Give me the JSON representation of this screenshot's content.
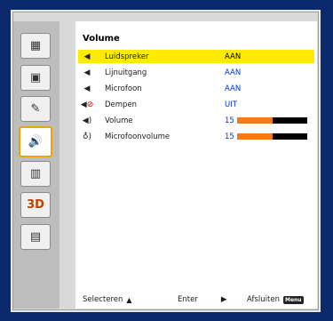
{
  "menu": {
    "title": "Volume",
    "items": [
      {
        "label": "Luidspreker",
        "value": "AAN",
        "icon": "speaker-icon",
        "selected": true
      },
      {
        "label": "Lijnuitgang",
        "value": "AAN",
        "icon": "speaker-icon",
        "selected": false
      },
      {
        "label": "Microfoon",
        "value": "AAN",
        "icon": "speaker-icon",
        "selected": false
      },
      {
        "label": "Dempen",
        "value": "UIT",
        "icon": "mute-icon",
        "selected": false
      },
      {
        "label": "Volume",
        "value": "15",
        "icon": "volume-icon",
        "level": 0.5,
        "selected": false
      },
      {
        "label": "Microfoonvolume",
        "value": "15",
        "icon": "microphone-icon",
        "level": 0.5,
        "selected": false
      }
    ]
  },
  "sidebar": {
    "items": [
      {
        "icon": "image-settings-icon"
      },
      {
        "icon": "display-icon"
      },
      {
        "icon": "setup-icon"
      },
      {
        "icon": "volume-icon",
        "active": true
      },
      {
        "icon": "options-icon"
      },
      {
        "icon": "3d-icon",
        "text": "3D"
      },
      {
        "icon": "lan-icon"
      }
    ]
  },
  "footer": {
    "select_label": "Selecteren",
    "enter_label": "Enter",
    "exit_label": "Afsluiten",
    "exit_key": "Menu"
  },
  "colors": {
    "background": "#0b2a6e",
    "selected_row": "#ffeb00",
    "bar_fill": "#f07a1e",
    "value_text": "#0033cc",
    "active_border": "#f0a400"
  }
}
